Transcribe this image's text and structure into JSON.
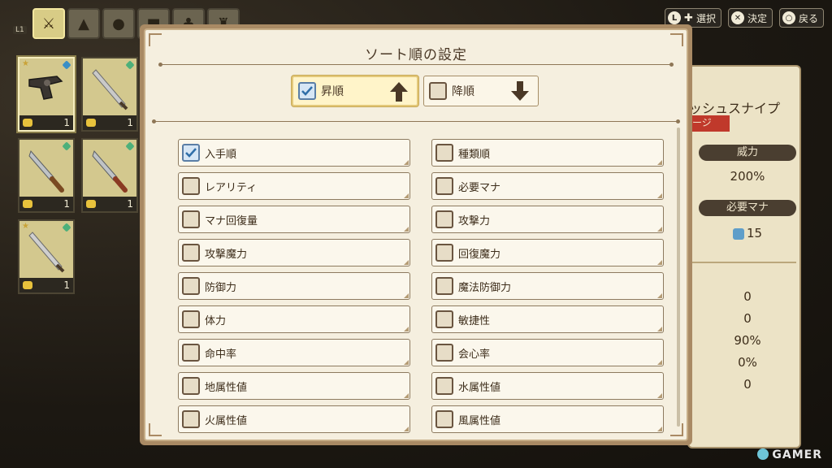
{
  "hints": [
    {
      "glyph": "L",
      "label": "選択"
    },
    {
      "glyph": "✕",
      "label": "決定"
    },
    {
      "glyph": "○",
      "label": "戻る"
    }
  ],
  "tabs_prefix": "L1",
  "items": [
    {
      "count": "1"
    },
    {
      "count": "1"
    },
    {
      "count": "1"
    },
    {
      "count": "1"
    },
    {
      "count": "1"
    }
  ],
  "right_panel": {
    "name": "ッシュスナイプ",
    "tag": "ージ",
    "power_label": "威力",
    "power_value": "200%",
    "mana_label": "必要マナ",
    "mana_value": "15",
    "stats": [
      "0",
      "0",
      "90%",
      "0%",
      "0"
    ]
  },
  "dialog": {
    "title": "ソート順の設定",
    "ascending": {
      "label": "昇順",
      "checked": true
    },
    "descending": {
      "label": "降順",
      "checked": false
    },
    "options_left": [
      {
        "label": "入手順",
        "checked": true
      },
      {
        "label": "レアリティ",
        "checked": false
      },
      {
        "label": "マナ回復量",
        "checked": false
      },
      {
        "label": "攻撃魔力",
        "checked": false
      },
      {
        "label": "防御力",
        "checked": false
      },
      {
        "label": "体力",
        "checked": false
      },
      {
        "label": "命中率",
        "checked": false
      },
      {
        "label": "地属性値",
        "checked": false
      },
      {
        "label": "火属性値",
        "checked": false
      }
    ],
    "options_right": [
      {
        "label": "種類順",
        "checked": false
      },
      {
        "label": "必要マナ",
        "checked": false
      },
      {
        "label": "攻撃力",
        "checked": false
      },
      {
        "label": "回復魔力",
        "checked": false
      },
      {
        "label": "魔法防御力",
        "checked": false
      },
      {
        "label": "敏捷性",
        "checked": false
      },
      {
        "label": "会心率",
        "checked": false
      },
      {
        "label": "水属性値",
        "checked": false
      },
      {
        "label": "風属性値",
        "checked": false
      }
    ]
  },
  "watermark": "GAMER"
}
